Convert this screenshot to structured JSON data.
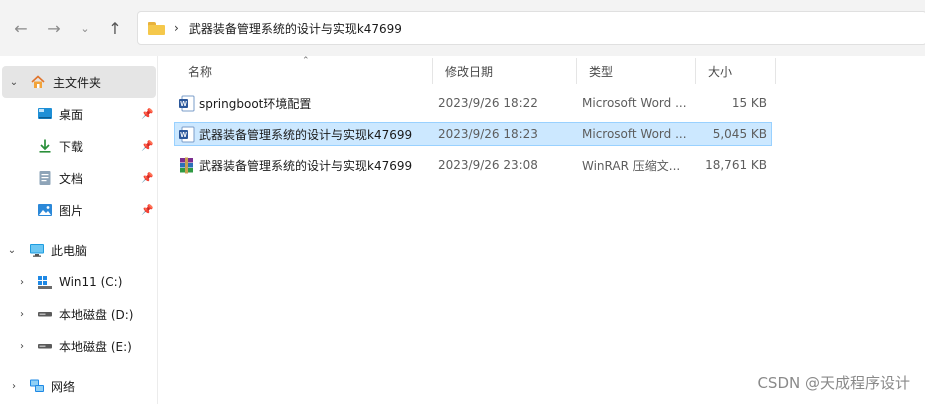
{
  "toolbar": {
    "back_glyph": "←",
    "forward_glyph": "→",
    "recent_glyph": "⌄",
    "up_glyph": "↑"
  },
  "address": {
    "separator": "›",
    "crumb": "武器装备管理系统的设计与实现k47699"
  },
  "navpane": {
    "quick_access": "主文件夹",
    "pinned": [
      {
        "label": "桌面",
        "icon": "desktop-icon"
      },
      {
        "label": "下载",
        "icon": "download-icon"
      },
      {
        "label": "文档",
        "icon": "document-icon"
      },
      {
        "label": "图片",
        "icon": "pictures-icon"
      }
    ],
    "this_pc": "此电脑",
    "drives": [
      {
        "label": "Win11 (C:)"
      },
      {
        "label": "本地磁盘 (D:)"
      },
      {
        "label": "本地磁盘 (E:)"
      }
    ],
    "network": "网络"
  },
  "columns": {
    "name": "名称",
    "date": "修改日期",
    "type": "类型",
    "size": "大小"
  },
  "files": [
    {
      "name": "springboot环境配置",
      "date": "2023/9/26 18:22",
      "type": "Microsoft Word ...",
      "size": "15 KB",
      "icon": "word-doc-icon"
    },
    {
      "name": "武器装备管理系统的设计与实现k47699",
      "date": "2023/9/26 18:23",
      "type": "Microsoft Word ...",
      "size": "5,045 KB",
      "icon": "word-doc-icon"
    },
    {
      "name": "武器装备管理系统的设计与实现k47699",
      "date": "2023/9/26 23:08",
      "type": "WinRAR 压缩文...",
      "size": "18,761 KB",
      "icon": "winrar-archive-icon"
    }
  ],
  "watermark": "CSDN @天成程序设计",
  "colors": {
    "selection_bg": "#cce8ff",
    "selection_border": "#99d1ff",
    "word_blue": "#2b579a",
    "folder_yellow": "#f5c84b"
  }
}
